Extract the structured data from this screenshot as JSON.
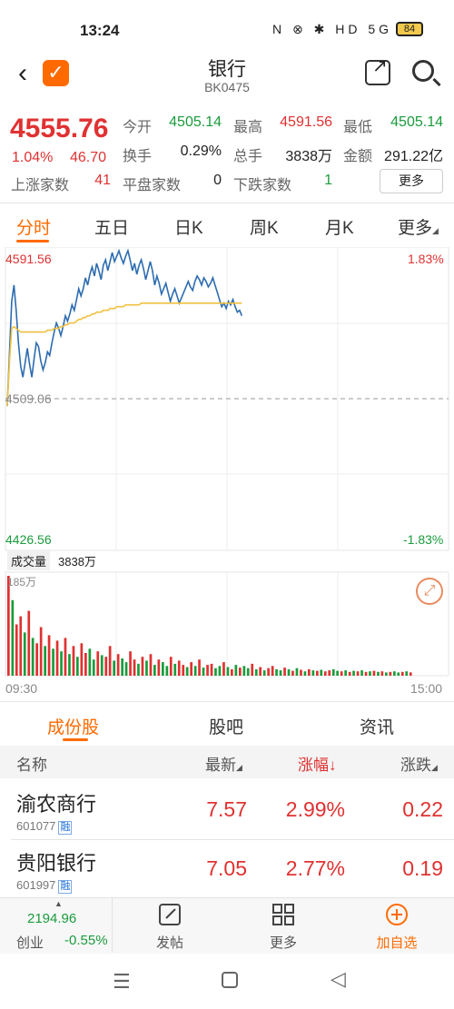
{
  "status": {
    "time": "13:24",
    "icons": "N ⊗ ✱ HD 5G ıll",
    "battery": "84"
  },
  "header": {
    "title": "银行",
    "code": "BK0475"
  },
  "quote": {
    "price": "4555.76",
    "pct": "1.04%",
    "change": "46.70",
    "open_label": "今开",
    "open": "4505.14",
    "high_label": "最高",
    "high": "4591.56",
    "low_label": "最低",
    "low": "4505.14",
    "turnover_label": "换手",
    "turnover": "0.29%",
    "volume_label": "总手",
    "volume": "3838万",
    "amount_label": "金额",
    "amount": "291.22亿",
    "up_label": "上涨家数",
    "up": "41",
    "flat_label": "平盘家数",
    "flat": "0",
    "down_label": "下跌家数",
    "down": "1",
    "more": "更多"
  },
  "tabs": [
    "分时",
    "五日",
    "日K",
    "周K",
    "月K",
    "更多"
  ],
  "chart_labels": {
    "top_price": "4591.56",
    "top_pct": "1.83%",
    "mid_price": "4509.06",
    "bottom_price": "4426.56",
    "bottom_pct": "-1.83%",
    "vol_label": "成交量",
    "vol_value": "3838万",
    "vol_max": "185万",
    "start_time": "09:30",
    "end_time": "15:00"
  },
  "chart_data": {
    "type": "line",
    "ylim": [
      4426.56,
      4591.56
    ],
    "base": 4509.06,
    "series": [
      {
        "values": [
          4505,
          4535,
          4563,
          4572,
          4558,
          4540,
          4527,
          4521,
          4529,
          4537,
          4528,
          4521,
          4531,
          4540,
          4538,
          4530,
          4525,
          4529,
          4535,
          4533,
          4540,
          4546,
          4551,
          4548,
          4544,
          4549,
          4555,
          4552,
          4556,
          4561,
          4558,
          4564,
          4570,
          4566,
          4570,
          4576,
          4572,
          4578,
          4582,
          4577,
          4584,
          4580,
          4575,
          4583,
          4586,
          4580,
          4585,
          4590,
          4585,
          4588,
          4591,
          4587,
          4584,
          4588,
          4591,
          4586,
          4580,
          4584,
          4578,
          4583,
          4586,
          4581,
          4575,
          4580,
          4585,
          4580,
          4572,
          4577,
          4573,
          4567,
          4570,
          4573,
          4568,
          4563,
          4567,
          4570,
          4566,
          4562,
          4565,
          4568,
          4571,
          4574,
          4571,
          4569,
          4574,
          4577,
          4575,
          4572,
          4576,
          4574,
          4571,
          4573,
          4576,
          4572,
          4568,
          4564,
          4560,
          4562,
          4559,
          4563,
          4561,
          4564,
          4560,
          4557,
          4558,
          4555
        ]
      },
      {
        "values": [
          4505,
          4530,
          4548,
          4549,
          4548,
          4547,
          4546,
          4546,
          4546,
          4546,
          4546,
          4546,
          4546,
          4546,
          4546,
          4546,
          4546,
          4546,
          4547,
          4547,
          4547,
          4548,
          4548,
          4548,
          4549,
          4549,
          4550,
          4550,
          4551,
          4551,
          4551,
          4552,
          4553,
          4553,
          4554,
          4554,
          4555,
          4555,
          4556,
          4556,
          4557,
          4557,
          4557,
          4558,
          4558,
          4558,
          4559,
          4559,
          4559,
          4560,
          4560,
          4560,
          4560,
          4561,
          4561,
          4561,
          4561,
          4561,
          4561,
          4561,
          4562,
          4562,
          4562,
          4562,
          4562,
          4562,
          4562,
          4562,
          4562,
          4562,
          4562,
          4562,
          4562,
          4562,
          4562,
          4562,
          4562,
          4562,
          4562,
          4562,
          4562,
          4562,
          4562,
          4562,
          4562,
          4562,
          4562,
          4562,
          4562,
          4562,
          4562,
          4562,
          4562,
          4562,
          4562,
          4562,
          4562,
          4562,
          4562,
          4562,
          4562,
          4562,
          4562,
          4562,
          4562,
          4562
        ]
      }
    ],
    "volume_max": 185,
    "volume": [
      185,
      140,
      95,
      110,
      80,
      120,
      70,
      60,
      90,
      55,
      75,
      50,
      65,
      45,
      70,
      40,
      55,
      35,
      60,
      42,
      50,
      30,
      45,
      38,
      35,
      55,
      28,
      40,
      32,
      25,
      45,
      30,
      22,
      35,
      28,
      40,
      20,
      30,
      25,
      18,
      35,
      22,
      28,
      20,
      16,
      25,
      18,
      30,
      15,
      20,
      22,
      14,
      18,
      25,
      16,
      12,
      20,
      15,
      18,
      14,
      22,
      12,
      16,
      10,
      14,
      18,
      12,
      10,
      15,
      12,
      9,
      14,
      11,
      8,
      12,
      10,
      9,
      11,
      8,
      10,
      12,
      9,
      8,
      10,
      7,
      9,
      8,
      10,
      7,
      8,
      9,
      7,
      8,
      6,
      7,
      8,
      6,
      7,
      8,
      6
    ],
    "volume_colors": [
      "r",
      "g",
      "r",
      "r",
      "g",
      "r",
      "g",
      "r",
      "r",
      "g",
      "r",
      "g",
      "r",
      "g",
      "r",
      "g",
      "r",
      "g",
      "r",
      "r",
      "g",
      "g",
      "r",
      "g",
      "r",
      "r",
      "g",
      "r",
      "g",
      "g",
      "r",
      "r",
      "g",
      "r",
      "g",
      "r",
      "g",
      "r",
      "g",
      "g",
      "r",
      "g",
      "r",
      "r",
      "g",
      "r",
      "g",
      "r",
      "g",
      "r",
      "r",
      "g",
      "g",
      "r",
      "g",
      "r",
      "g",
      "r",
      "g",
      "g",
      "r",
      "g",
      "r",
      "g",
      "r",
      "r",
      "g",
      "g",
      "r",
      "g",
      "r",
      "g",
      "r",
      "g",
      "r",
      "g",
      "r",
      "g",
      "r",
      "r",
      "g",
      "g",
      "r",
      "g",
      "r",
      "g",
      "r",
      "g",
      "r",
      "g",
      "r",
      "g",
      "r",
      "g",
      "r",
      "g",
      "g",
      "r",
      "g",
      "r"
    ]
  },
  "components": {
    "tabs": [
      "成份股",
      "股吧",
      "资讯"
    ]
  },
  "table": {
    "h_name": "名称",
    "h_latest": "最新",
    "h_pct": "涨幅↓",
    "h_chg": "涨跌",
    "rows": [
      {
        "name": "渝农商行",
        "code": "601077",
        "tag": "融",
        "latest": "7.57",
        "pct": "2.99%",
        "chg": "0.22"
      },
      {
        "name": "贵阳银行",
        "code": "601997",
        "tag": "融",
        "latest": "7.05",
        "pct": "2.77%",
        "chg": "0.19"
      }
    ]
  },
  "bottom": {
    "index_value": "2194.96",
    "index_name": "创业",
    "index_pct": "-0.55%",
    "post": "发帖",
    "more": "更多",
    "add": "加自选"
  },
  "colors": {
    "accent": "#ff6a00",
    "up": "#e03131",
    "down": "#1a9c3c",
    "line": "#2d6cb0",
    "avg": "#f0c040"
  }
}
